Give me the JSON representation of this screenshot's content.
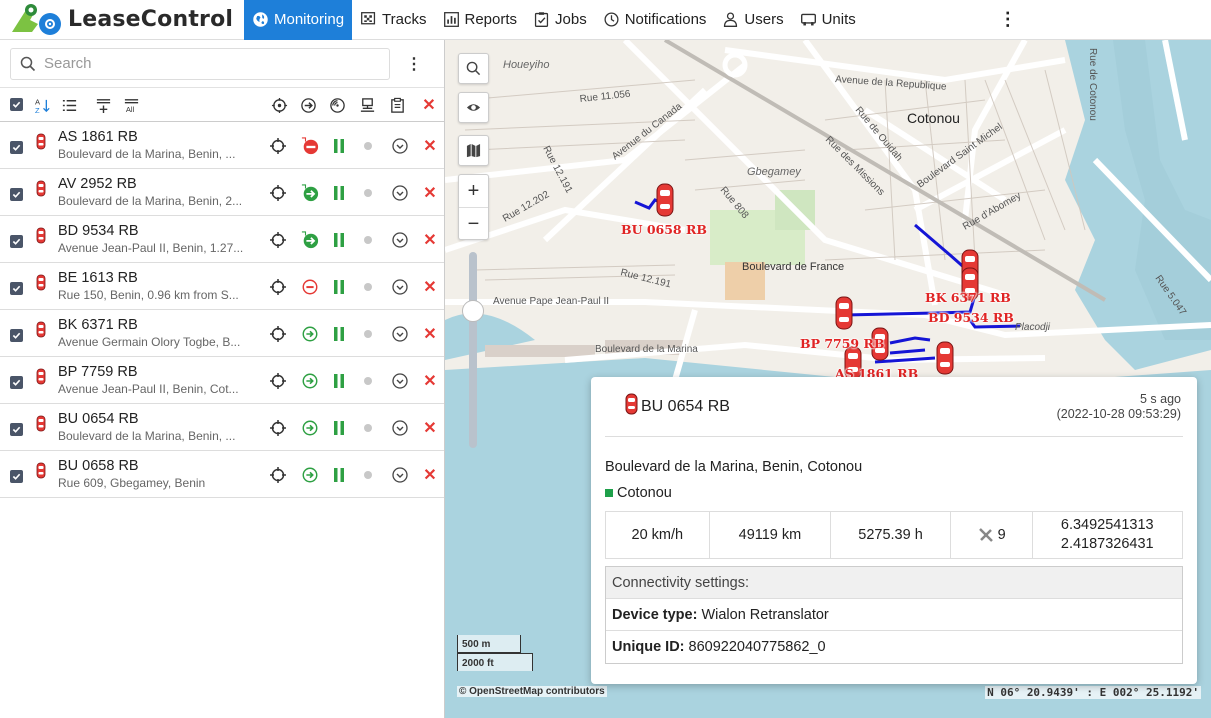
{
  "app": {
    "name": "LeaseControl"
  },
  "nav": {
    "items": [
      {
        "label": "Monitoring",
        "icon": "globe-icon",
        "active": true
      },
      {
        "label": "Tracks",
        "icon": "flag-icon"
      },
      {
        "label": "Reports",
        "icon": "report-icon"
      },
      {
        "label": "Jobs",
        "icon": "jobs-icon"
      },
      {
        "label": "Notifications",
        "icon": "clock-icon"
      },
      {
        "label": "Users",
        "icon": "user-icon"
      },
      {
        "label": "Units",
        "icon": "car-icon"
      }
    ],
    "more": "⋮"
  },
  "search": {
    "placeholder": "Search",
    "more": "⋮"
  },
  "toolbar": {
    "all_label": "All",
    "delete": "✕"
  },
  "units": [
    {
      "name": "AS 1861 RB",
      "address": "Boulevard de la Marina, Benin, ...",
      "status": "stopped"
    },
    {
      "name": "AV 2952 RB",
      "address": "Boulevard de la Marina, Benin, 2...",
      "status": "moving"
    },
    {
      "name": "BD 9534 RB",
      "address": "Avenue Jean-Paul II, Benin, 1.27...",
      "status": "moving"
    },
    {
      "name": "BE 1613 RB",
      "address": "Rue 150, Benin, 0.96 km from S...",
      "status": "stopped-outline"
    },
    {
      "name": "BK 6371 RB",
      "address": "Avenue Germain Olory Togbe, B...",
      "status": "moving-outline"
    },
    {
      "name": "BP 7759 RB",
      "address": "Avenue Jean-Paul II, Benin, Cot...",
      "status": "moving-outline"
    },
    {
      "name": "BU 0654 RB",
      "address": "Boulevard de la Marina, Benin, ...",
      "status": "moving-outline"
    },
    {
      "name": "BU 0658 RB",
      "address": "Rue 609, Gbegamey, Benin",
      "status": "moving-outline"
    }
  ],
  "map": {
    "labels": {
      "cotonou": "Cotonou",
      "gbegamey": "Gbegamey",
      "houeyiho": "Houeyiho",
      "bd_france": "Boulevard de France",
      "av_pape": "Avenue Pape Jean-Paul II",
      "bd_marina": "Boulevard de la Marina",
      "av_republique": "Avenue de la Republique",
      "rue_11056": "Rue 11.056",
      "av_canada": "Avenue du Canada",
      "rue_12191": "Rue 12.191",
      "rue_12202": "Rue 12.202",
      "rue_12191b": "Rue 12.191",
      "rue_ouidah": "Rue de Ouidah",
      "rue_missions": "Rue des Missions",
      "bd_st_michel": "Boulevard Saint Michel",
      "rue_abomey": "Rue d'Abomey",
      "rue_808": "Rue 808",
      "placodji": "Placodji",
      "rue_5047": "Rue 5.047",
      "rue_de_cotonou": "Rue de Cotonou"
    },
    "vehicle_labels": [
      "BU 0658 RB",
      "BK 6371 RB",
      "BD 9534 RB",
      "BP 7759 RB",
      "AS 1861 RB"
    ],
    "scale_metric": "500 m",
    "scale_imperial": "2000 ft",
    "attribution": "© OpenStreetMap contributors",
    "coordinates": "N 06° 20.9439' : E 002° 25.1192'"
  },
  "popup": {
    "title": "BU 0654 RB",
    "time_ago": "5 s ago",
    "timestamp": "(2022-10-28 09:53:29)",
    "address": "Boulevard de la Marina, Benin, Cotonou",
    "zone": "Cotonou",
    "speed": "20 km/h",
    "mileage": "49119 km",
    "engine_hours": "5275.39 h",
    "satellites": "9",
    "lat": "6.3492541313",
    "lon": "2.4187326431",
    "conn_header": "Connectivity settings:",
    "device_type_label": "Device type:",
    "device_type": "Wialon Retranslator",
    "unique_id_label": "Unique ID:",
    "unique_id": "860922040775862_0"
  },
  "colors": {
    "accent": "#1e7fd9",
    "danger": "#e53935",
    "success": "#2ea043",
    "track": "#1515d6"
  }
}
